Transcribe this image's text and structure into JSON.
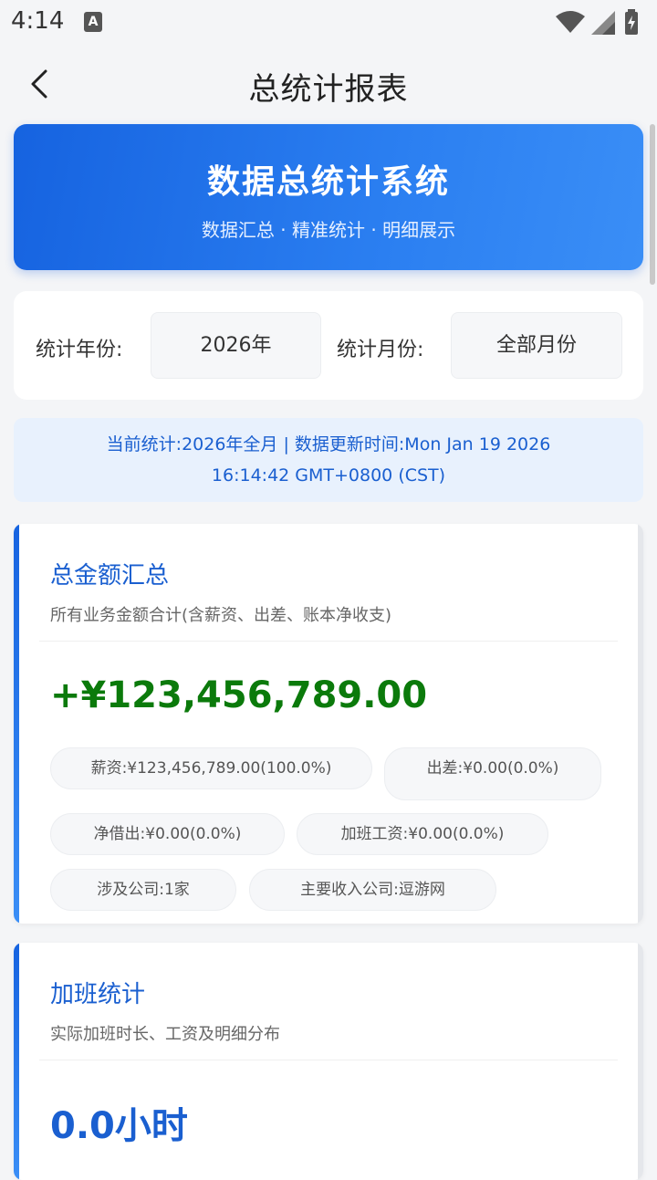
{
  "status_bar": {
    "time": "4:14",
    "notification_badge": "A"
  },
  "app_bar": {
    "title": "总统计报表"
  },
  "hero": {
    "title": "数据总统计系统",
    "subtitle": "数据汇总 · 精准统计 · 明细展示"
  },
  "filters": {
    "year_label": "统计年份:",
    "year_value": "2026年",
    "month_label": "统计月份:",
    "month_value": "全部月份"
  },
  "notice": {
    "line1": "当前统计:2026年全月 | 数据更新时间:Mon Jan 19 2026",
    "line2": "16:14:42 GMT+0800 (CST)"
  },
  "total_card": {
    "title": "总金额汇总",
    "subtitle": "所有业务金额合计(含薪资、出差、账本净收支)",
    "value": "+¥123,456,789.00",
    "value_color": "#0b7a0b",
    "chips": [
      "薪资:¥123,456,789.00(100.0%)",
      "出差:¥0.00(0.0%)",
      "净借出:¥0.00(0.0%)",
      "加班工资:¥0.00(0.0%)",
      "涉及公司:1家",
      "主要收入公司:逗游网"
    ]
  },
  "overtime_card": {
    "title": "加班统计",
    "subtitle": "实际加班时长、工资及明细分布",
    "value": "0.0小时",
    "value_color": "#1a5fd0"
  },
  "colors": {
    "accent": "#1a5fd0",
    "hero_start": "#1663e0",
    "hero_end": "#3a8ef6",
    "positive": "#0b7a0b"
  }
}
